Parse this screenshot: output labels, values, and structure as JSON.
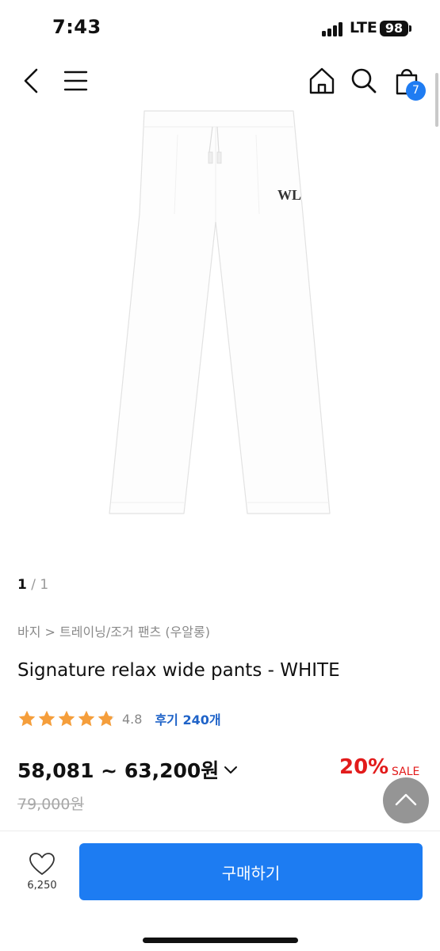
{
  "status_bar": {
    "time": "7:43",
    "network": "LTE",
    "battery": "98"
  },
  "header": {
    "cart_count": "7"
  },
  "product": {
    "image_logo": "WL",
    "pager_current": "1",
    "pager_sep": " / ",
    "pager_total": "1",
    "breadcrumb": "바지 > 트레이닝/조거 팬츠 (우알롱)",
    "title": "Signature relax wide pants - WHITE",
    "rating": {
      "stars": 4.8,
      "score": "4.8",
      "reviews": "후기 240개"
    },
    "price_range": "58,081 ~ 63,200원",
    "discount": "20%",
    "sale_label": "SALE",
    "original_price": "79,000원"
  },
  "footer": {
    "like_count": "6,250",
    "buy_label": "구매하기"
  },
  "colors": {
    "accent": "#1d7cf2",
    "sale": "#e21b1b",
    "star": "#f59e3b"
  }
}
